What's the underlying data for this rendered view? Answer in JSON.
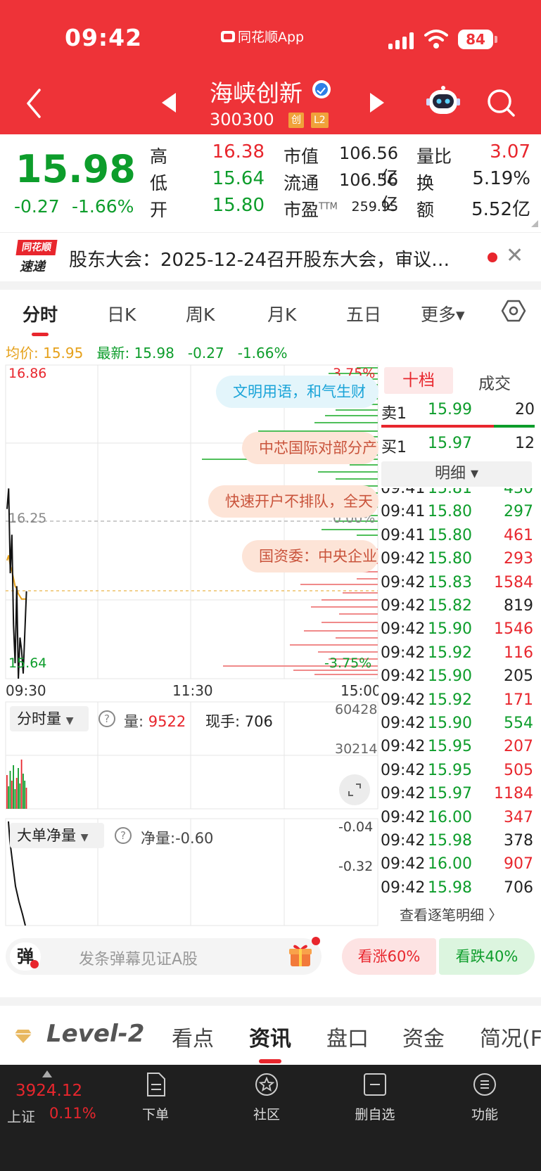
{
  "status": {
    "time": "09:42",
    "app_name": "同花顺App",
    "battery": "84"
  },
  "header": {
    "stock_name": "海峡创新",
    "stock_code": "300300",
    "tags": [
      "创",
      "L2"
    ]
  },
  "quote": {
    "price": "15.98",
    "change": "-0.27",
    "change_pct": "-1.66%",
    "stats": {
      "high_label": "高",
      "high": "16.38",
      "low_label": "低",
      "low": "15.64",
      "open_label": "开",
      "open": "15.80",
      "mktcap_label": "市值",
      "mktcap": "106.56亿",
      "float_label": "流通",
      "float": "106.56亿",
      "pe_label": "市盈",
      "pe_sup": "TTM",
      "pe": "259.95",
      "volratio_label": "量比",
      "volratio": "3.07",
      "turnover_label": "换",
      "turnover": "5.19%",
      "amount_label": "额",
      "amount": "5.52亿"
    }
  },
  "news": {
    "logo_top": "同花顺",
    "logo_bottom": "速递",
    "text": "股东大会：2025-12-24召开股东大会，审议…"
  },
  "tabs": [
    "分时",
    "日K",
    "周K",
    "月K",
    "五日",
    "更多▾"
  ],
  "avg_line": {
    "avg_label": "均价:",
    "avg": "15.95",
    "last_label": "最新:",
    "last": "15.98",
    "chg": "-0.27",
    "pct": "-1.66%"
  },
  "chart": {
    "price_high": "16.86",
    "price_mid": "16.25",
    "price_low": "15.64",
    "pct_high": "3.75%",
    "pct_mid": "0.00%",
    "pct_low": "-3.75%",
    "times": [
      "09:30",
      "11:30",
      "15:00"
    ],
    "bubbles": [
      "文明用语，和气生财",
      "中芯国际对部分产",
      "快速开户不排队，全天",
      "国资委：中央企业"
    ]
  },
  "chart_data": {
    "type": "line",
    "x": [
      "09:30",
      "09:31",
      "09:32",
      "09:33",
      "09:34",
      "09:35",
      "09:36",
      "09:37",
      "09:38",
      "09:39",
      "09:40",
      "09:41",
      "09:42"
    ],
    "series": [
      {
        "values": [
          16.3,
          16.38,
          16.05,
          16.2,
          15.85,
          15.7,
          16.0,
          15.64,
          15.8,
          15.75,
          15.66,
          15.82,
          15.98
        ]
      },
      {
        "values": [
          16.1,
          16.12,
          16.08,
          16.06,
          16.03,
          16.0,
          15.99,
          15.97,
          15.96,
          15.95,
          15.95,
          15.95,
          15.95
        ]
      }
    ],
    "ylim": [
      15.64,
      16.86
    ]
  },
  "volume": {
    "selector": "分时量",
    "vol_label": "量:",
    "vol": "9522",
    "hand_label": "现手:",
    "hand": "706",
    "top": "60428",
    "mid": "30214"
  },
  "flow": {
    "selector": "大单净量",
    "net_label": "净量:",
    "net": "-0.60",
    "top": "-0.04",
    "mid": "-0.32"
  },
  "side": {
    "tab_active": "十档",
    "tab_deal": "成交",
    "sell1_label": "卖1",
    "sell1_price": "15.99",
    "sell1_vol": "20",
    "buy1_label": "买1",
    "buy1_price": "15.97",
    "buy1_vol": "12",
    "detail_btn": "明细 ▾",
    "more": "查看逐笔明细 〉",
    "ticks": [
      {
        "t": "09:41",
        "p": "15.81",
        "v": "430",
        "pc": "green",
        "vc": "green"
      },
      {
        "t": "09:41",
        "p": "15.80",
        "v": "297",
        "pc": "green",
        "vc": "green"
      },
      {
        "t": "09:41",
        "p": "15.80",
        "v": "461",
        "pc": "green",
        "vc": "red"
      },
      {
        "t": "09:42",
        "p": "15.80",
        "v": "293",
        "pc": "green",
        "vc": "red"
      },
      {
        "t": "09:42",
        "p": "15.83",
        "v": "1584",
        "pc": "green",
        "vc": "red"
      },
      {
        "t": "09:42",
        "p": "15.82",
        "v": "819",
        "pc": "green",
        "vc": "dark"
      },
      {
        "t": "09:42",
        "p": "15.90",
        "v": "1546",
        "pc": "green",
        "vc": "red"
      },
      {
        "t": "09:42",
        "p": "15.92",
        "v": "116",
        "pc": "green",
        "vc": "red"
      },
      {
        "t": "09:42",
        "p": "15.90",
        "v": "205",
        "pc": "green",
        "vc": "dark"
      },
      {
        "t": "09:42",
        "p": "15.92",
        "v": "171",
        "pc": "green",
        "vc": "red"
      },
      {
        "t": "09:42",
        "p": "15.90",
        "v": "554",
        "pc": "green",
        "vc": "green"
      },
      {
        "t": "09:42",
        "p": "15.95",
        "v": "207",
        "pc": "green",
        "vc": "red"
      },
      {
        "t": "09:42",
        "p": "15.95",
        "v": "505",
        "pc": "green",
        "vc": "red"
      },
      {
        "t": "09:42",
        "p": "15.97",
        "v": "1184",
        "pc": "green",
        "vc": "red"
      },
      {
        "t": "09:42",
        "p": "16.00",
        "v": "347",
        "pc": "green",
        "vc": "red"
      },
      {
        "t": "09:42",
        "p": "15.98",
        "v": "378",
        "pc": "green",
        "vc": "dark"
      },
      {
        "t": "09:42",
        "p": "16.00",
        "v": "907",
        "pc": "green",
        "vc": "red"
      },
      {
        "t": "09:42",
        "p": "15.98",
        "v": "706",
        "pc": "green",
        "vc": "dark"
      }
    ]
  },
  "danmu": {
    "icon": "弹",
    "placeholder": "发条弹幕见证A股",
    "vote_up": "看涨60%",
    "vote_down": "看跌40%"
  },
  "content_tabs": {
    "level2": "Level-2",
    "tabs": [
      "看点",
      "资讯",
      "盘口",
      "资金",
      "简况(F"
    ]
  },
  "bottom_nav": {
    "index_value": "3924.12",
    "index_name": "上证",
    "index_pct": "0.11%",
    "items": [
      "下单",
      "社区",
      "删自选",
      "功能"
    ]
  },
  "colors": {
    "header_red": "#ee3338",
    "up_red": "#e8262d",
    "down_green": "#0d9d2b",
    "avg_orange": "#e6a11b"
  }
}
